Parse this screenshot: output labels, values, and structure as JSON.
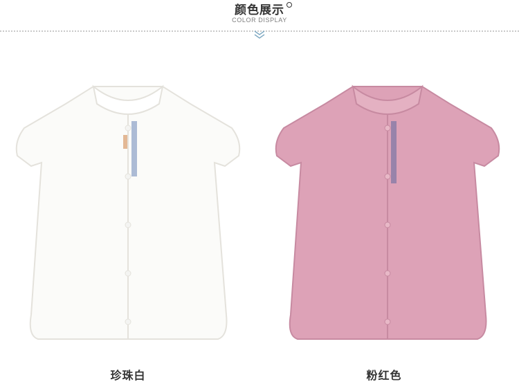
{
  "header": {
    "title": "颜色展示",
    "subtitle": "COLOR DISPLAY"
  },
  "products": [
    {
      "color_name": "珍珠白",
      "fill": "#fbfbf9",
      "shade": "#e4e2dc"
    },
    {
      "color_name": "粉红色",
      "fill": "#dda2b7",
      "shade": "#c78aa1"
    }
  ],
  "colors": {
    "chevron": "#7fa9c2",
    "text": "#333333",
    "divider": "#c9c9c9"
  }
}
